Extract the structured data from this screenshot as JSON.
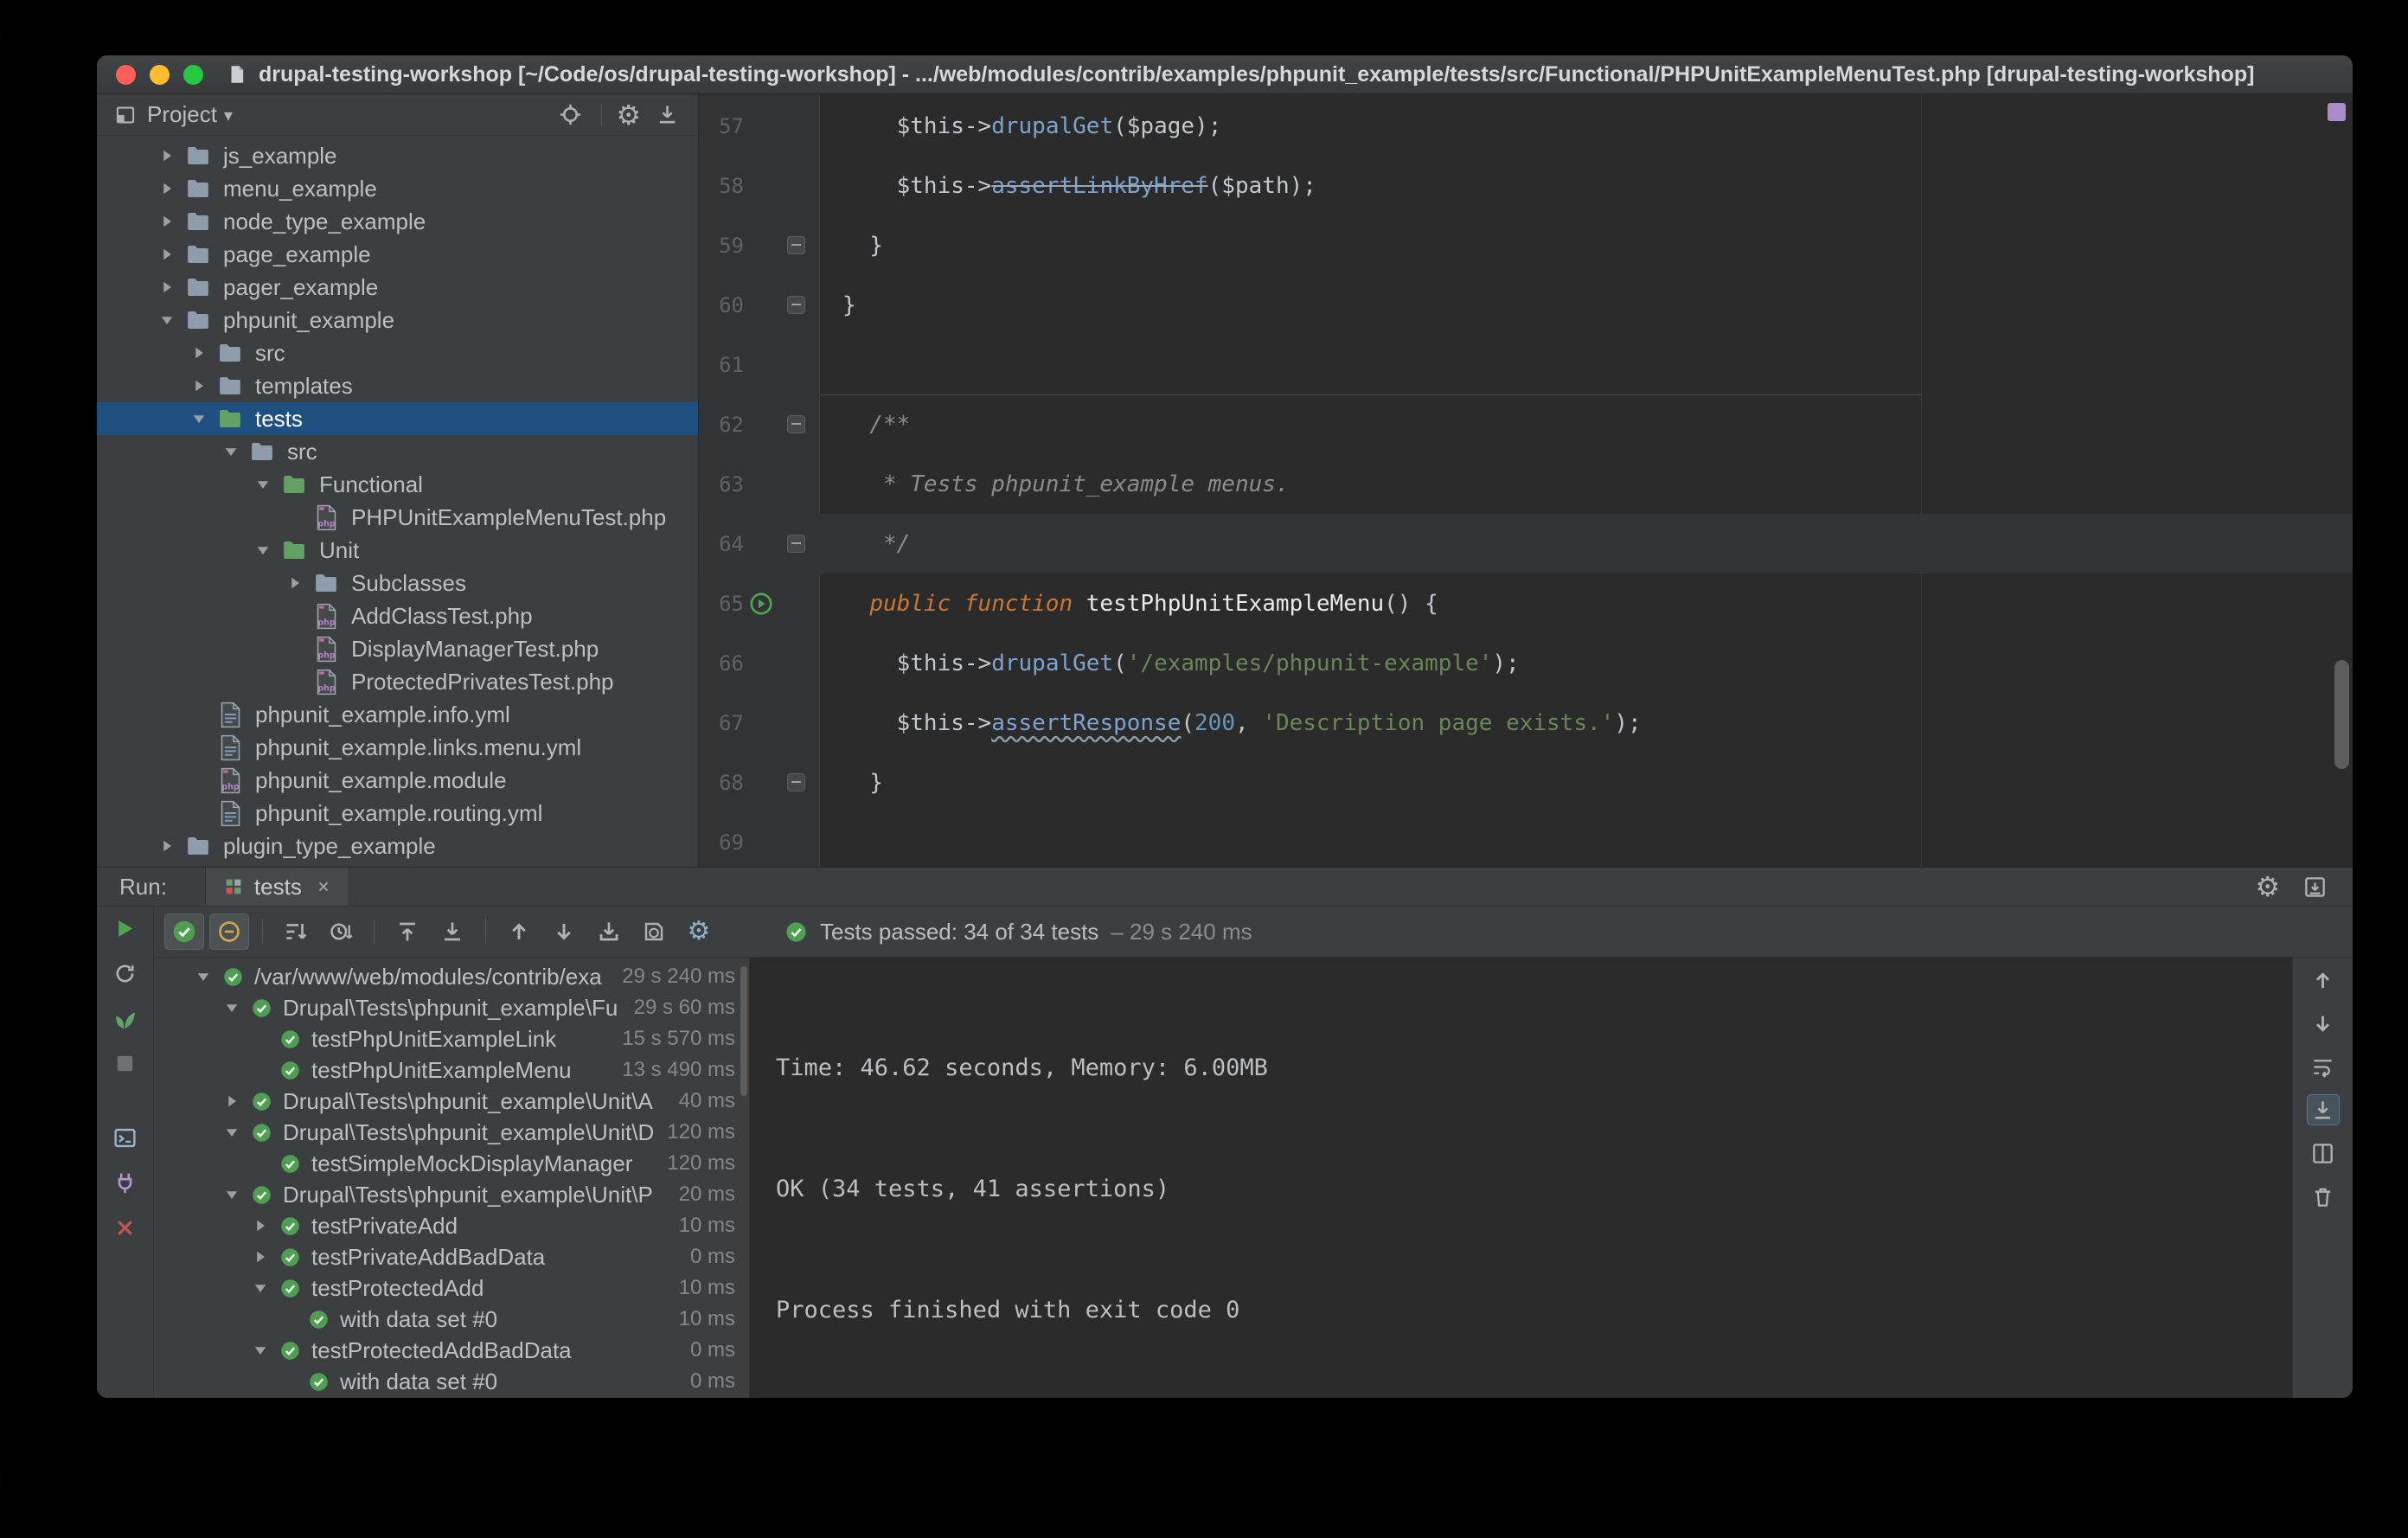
{
  "palette": {
    "window_bg": "#3C3F41",
    "editor_bg": "#2B2B2B",
    "selection_blue": "#1F5080",
    "accent_green": "#4DA54D",
    "error_red": "#C75450",
    "keyword_orange": "#CC7832",
    "string_green": "#6A8759",
    "method_blue": "#7EA3CF"
  },
  "icons": {
    "gear": "⚙",
    "caret_down": "▾"
  },
  "titlebar": {
    "title": "drupal-testing-workshop [~/Code/os/drupal-testing-workshop] - .../web/modules/contrib/examples/phpunit_example/tests/src/Functional/PHPUnitExampleMenuTest.php [drupal-testing-workshop]"
  },
  "project_panel": {
    "title": "Project",
    "items": [
      {
        "label": "js_example",
        "level": 0,
        "type": "folder",
        "state": "collapsed"
      },
      {
        "label": "menu_example",
        "level": 0,
        "type": "folder",
        "state": "collapsed"
      },
      {
        "label": "node_type_example",
        "level": 0,
        "type": "folder",
        "state": "collapsed"
      },
      {
        "label": "page_example",
        "level": 0,
        "type": "folder",
        "state": "collapsed"
      },
      {
        "label": "pager_example",
        "level": 0,
        "type": "folder",
        "state": "collapsed"
      },
      {
        "label": "phpunit_example",
        "level": 0,
        "type": "folder",
        "state": "expanded"
      },
      {
        "label": "src",
        "level": 1,
        "type": "folder",
        "state": "collapsed"
      },
      {
        "label": "templates",
        "level": 1,
        "type": "folder",
        "state": "collapsed"
      },
      {
        "label": "tests",
        "level": 1,
        "type": "folder-test",
        "state": "expanded",
        "selected": true
      },
      {
        "label": "src",
        "level": 2,
        "type": "folder",
        "state": "expanded"
      },
      {
        "label": "Functional",
        "level": 3,
        "type": "folder-test",
        "state": "expanded"
      },
      {
        "label": "PHPUnitExampleMenuTest.php",
        "level": 4,
        "type": "php-test"
      },
      {
        "label": "Unit",
        "level": 3,
        "type": "folder-test",
        "state": "expanded"
      },
      {
        "label": "Subclasses",
        "level": 4,
        "type": "folder",
        "state": "collapsed"
      },
      {
        "label": "AddClassTest.php",
        "level": 4,
        "type": "php-test"
      },
      {
        "label": "DisplayManagerTest.php",
        "level": 4,
        "type": "php-test"
      },
      {
        "label": "ProtectedPrivatesTest.php",
        "level": 4,
        "type": "php-test"
      },
      {
        "label": "phpunit_example.info.yml",
        "level": 1,
        "type": "yml"
      },
      {
        "label": "phpunit_example.links.menu.yml",
        "level": 1,
        "type": "yml"
      },
      {
        "label": "phpunit_example.module",
        "level": 1,
        "type": "php"
      },
      {
        "label": "phpunit_example.routing.yml",
        "level": 1,
        "type": "yml"
      },
      {
        "label": "plugin_type_example",
        "level": 0,
        "type": "folder",
        "state": "collapsed"
      }
    ]
  },
  "editor": {
    "lines": [
      {
        "no": 57,
        "tokens": [
          {
            "t": "    "
          },
          {
            "t": "$this",
            "c": "var"
          },
          {
            "t": "->"
          },
          {
            "t": "drupalGet",
            "c": "method"
          },
          {
            "t": "("
          },
          {
            "t": "$page",
            "c": "var"
          },
          {
            "t": ");"
          }
        ]
      },
      {
        "no": 58,
        "tokens": [
          {
            "t": "    "
          },
          {
            "t": "$this",
            "c": "var"
          },
          {
            "t": "->"
          },
          {
            "t": "assertLinkByHref",
            "c": "deprecated"
          },
          {
            "t": "("
          },
          {
            "t": "$path",
            "c": "var"
          },
          {
            "t": ");"
          }
        ]
      },
      {
        "no": 59,
        "fold": true,
        "tokens": [
          {
            "t": "  }"
          }
        ]
      },
      {
        "no": 60,
        "fold": true,
        "tokens": [
          {
            "t": "}"
          }
        ]
      },
      {
        "no": 61,
        "tokens": []
      },
      {
        "no": 62,
        "fold": true,
        "sep": true,
        "tokens": [
          {
            "t": "  /**",
            "c": "comment"
          }
        ]
      },
      {
        "no": 63,
        "tokens": [
          {
            "t": "   * Tests phpunit_example menus.",
            "c": "comment"
          }
        ]
      },
      {
        "no": 64,
        "fold": true,
        "current": true,
        "tokens": [
          {
            "t": "   */",
            "c": "comment"
          }
        ]
      },
      {
        "no": 65,
        "run": true,
        "tokens": [
          {
            "t": "  "
          },
          {
            "t": "public",
            "c": "kw"
          },
          {
            "t": " "
          },
          {
            "t": "function",
            "c": "kw"
          },
          {
            "t": " "
          },
          {
            "t": "testPhpUnitExampleMenu",
            "c": "decl"
          },
          {
            "t": "() {"
          }
        ]
      },
      {
        "no": 66,
        "tokens": [
          {
            "t": "    "
          },
          {
            "t": "$this",
            "c": "var"
          },
          {
            "t": "->"
          },
          {
            "t": "drupalGet",
            "c": "method"
          },
          {
            "t": "("
          },
          {
            "t": "'/examples/phpunit-example'",
            "c": "str"
          },
          {
            "t": ");"
          }
        ]
      },
      {
        "no": 67,
        "tokens": [
          {
            "t": "    "
          },
          {
            "t": "$this",
            "c": "var"
          },
          {
            "t": "->"
          },
          {
            "t": "assertResponse",
            "c": "warn"
          },
          {
            "t": "("
          },
          {
            "t": "200",
            "c": "num"
          },
          {
            "t": ", "
          },
          {
            "t": "'Description page exists.'",
            "c": "str"
          },
          {
            "t": ");"
          }
        ]
      },
      {
        "no": 68,
        "fold": true,
        "tokens": [
          {
            "t": "  }"
          }
        ]
      },
      {
        "no": 69,
        "tokens": []
      }
    ]
  },
  "run_panel": {
    "label": "Run:",
    "tab": {
      "label": "tests"
    },
    "status": {
      "text": "Tests passed: 34 of 34 tests",
      "duration": "– 29 s 240 ms"
    },
    "tests": [
      {
        "label": "/var/www/web/modules/contrib/exa",
        "level": 0,
        "state": "expanded",
        "dur": "29 s 240 ms"
      },
      {
        "label": "Drupal\\Tests\\phpunit_example\\Fu",
        "level": 1,
        "state": "expanded",
        "dur": "29 s 60 ms"
      },
      {
        "label": "testPhpUnitExampleLink",
        "level": 2,
        "dur": "15 s 570 ms"
      },
      {
        "label": "testPhpUnitExampleMenu",
        "level": 2,
        "dur": "13 s 490 ms"
      },
      {
        "label": "Drupal\\Tests\\phpunit_example\\Unit\\A",
        "level": 1,
        "state": "collapsed",
        "dur": "40 ms"
      },
      {
        "label": "Drupal\\Tests\\phpunit_example\\Unit\\D",
        "level": 1,
        "state": "expanded",
        "dur": "120 ms"
      },
      {
        "label": "testSimpleMockDisplayManager",
        "level": 2,
        "dur": "120 ms"
      },
      {
        "label": "Drupal\\Tests\\phpunit_example\\Unit\\P",
        "level": 1,
        "state": "expanded",
        "dur": "20 ms"
      },
      {
        "label": "testPrivateAdd",
        "level": 2,
        "state": "collapsed",
        "dur": "10 ms"
      },
      {
        "label": "testPrivateAddBadData",
        "level": 2,
        "state": "collapsed",
        "dur": "0 ms"
      },
      {
        "label": "testProtectedAdd",
        "level": 2,
        "state": "expanded",
        "dur": "10 ms"
      },
      {
        "label": "with data set #0",
        "level": 3,
        "dur": "10 ms"
      },
      {
        "label": "testProtectedAddBadData",
        "level": 2,
        "state": "expanded",
        "dur": "0 ms"
      },
      {
        "label": "with data set #0",
        "level": 3,
        "dur": "0 ms"
      }
    ],
    "console": {
      "lines": [
        "Time: 46.62 seconds, Memory: 6.00MB",
        "OK (34 tests, 41 assertions)",
        "Process finished with exit code 0"
      ]
    }
  }
}
